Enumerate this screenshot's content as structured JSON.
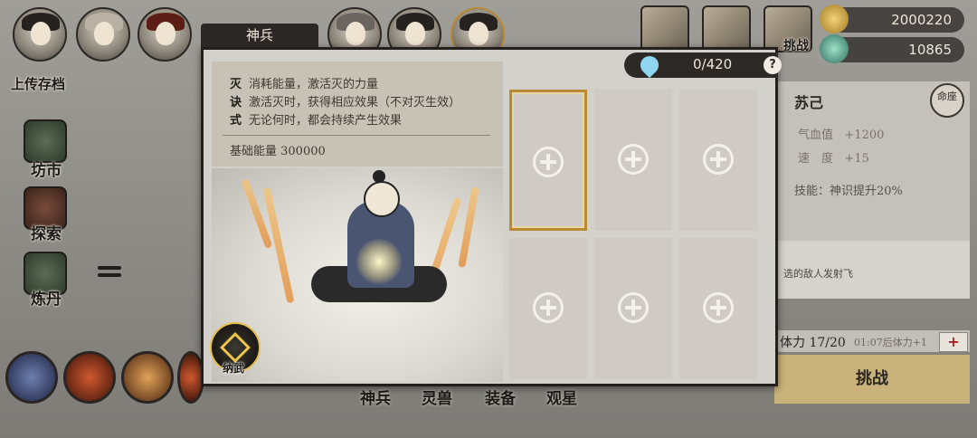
{
  "background": {
    "save_label": "上传存档",
    "left_menu": [
      {
        "label": "坊市"
      },
      {
        "label": "探索"
      },
      {
        "label": "炼丹"
      }
    ],
    "bottom_tabs": [
      "神兵",
      "灵兽",
      "装备",
      "观星"
    ],
    "challenge_tab": "挑战"
  },
  "currency": {
    "coins": "2000220",
    "jade": "10865"
  },
  "right_panel": {
    "name": "苏己",
    "badge": "命座",
    "stats": [
      {
        "label": "气血值",
        "value": "+1200"
      },
      {
        "label": "速　度",
        "value": "+15"
      }
    ],
    "skill": "技能：神识提升20%",
    "desc": "选的敌人发射飞",
    "stamina_label": "体力 17/20",
    "stamina_timer": "01:07后体力+1",
    "stamina_plus": "+",
    "challenge_button": "挑战"
  },
  "dialog": {
    "title": "神兵",
    "energy": "0/420",
    "help": "?",
    "lines": [
      {
        "key": "灭",
        "text": "消耗能量，激活灭的力量"
      },
      {
        "key": "诀",
        "text": "激活灭时，获得相应效果（不对灭生效）"
      },
      {
        "key": "式",
        "text": "无论何时，都会持续产生效果"
      }
    ],
    "base_energy": "基础能量 300000",
    "equip_label": "纳武",
    "slots": [
      {
        "selected": true
      },
      {
        "selected": false
      },
      {
        "selected": false
      },
      {
        "selected": false
      },
      {
        "selected": false
      },
      {
        "selected": false
      }
    ]
  },
  "colors": {
    "accent_gold": "#b98a33",
    "dialog_bg": "#d3d1cc",
    "dark": "#231f1c"
  }
}
